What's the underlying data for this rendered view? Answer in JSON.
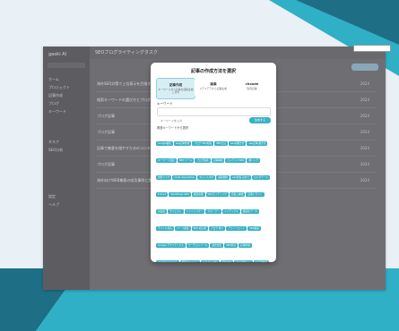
{
  "colors": {
    "teal_dark": "#1e6f86",
    "teal_mid": "#2fb0c6",
    "accent": "#3ab3c6",
    "page_bg": "#e9f1f7"
  },
  "app": {
    "logo": "gaoki AI",
    "page_title": "SEOブログライティングタスク",
    "stamp": ""
  },
  "sidebar": {
    "items": [
      "ホーム",
      "プロジェクト",
      "記事作成",
      "ブログ",
      "キーワード",
      "タスク",
      "SEO分析",
      "設定",
      "ヘルプ"
    ]
  },
  "list": {
    "rows": [
      {
        "title": "海外SEO対策で上位表示を目指すための基本戦略",
        "meta": "2024"
      },
      {
        "title": "検索キーワードの選び方とブログ記事の構成",
        "meta": "2024"
      },
      {
        "title": "ブログ記事",
        "meta": "2024"
      },
      {
        "title": "ブログ記事",
        "meta": "2024"
      },
      {
        "title": "記事で集客を増やすためのコンテンツSEO設計",
        "meta": "2024"
      },
      {
        "title": "ブログ記事",
        "meta": "2024"
      },
      {
        "title": "海外向けWEB集客の成功事例と実践ポイント",
        "meta": "2024"
      }
    ]
  },
  "modal": {
    "title": "記事の作成方法を選択",
    "options": [
      {
        "title": "記事作成",
        "sub": "キーワードから記事を自動生成します"
      },
      {
        "title": "画像",
        "sub": "Cアイデアから記事生成"
      },
      {
        "title": "choode",
        "sub": "既存記事"
      }
    ],
    "keyword_label": "キーワード",
    "keyword_placeholder": "キーワードを入力",
    "generate_button": "生成する",
    "suggest_label": "関連キーワードから選択",
    "tags": [
      "Google検索",
      "seo記事作成",
      "ブログ SEO対策",
      "SEOとは",
      "seoの書き方",
      "seo記事 書き方",
      "キーワード選定",
      "SEO ツール",
      "ブログ集客",
      "記事構成",
      "コンテンツSEO",
      "被リンク",
      "内部リンク",
      "meta description",
      "タイトルタグ",
      "検索順位",
      "seo対策 自分で",
      "ロングテール",
      "E-E-A-T",
      "WordPress SEO",
      "検索意図",
      "SEOライティング",
      "見出し構成",
      "記事リライト",
      "共起語",
      "サジェスト",
      "ドメインパワー",
      "クローラー",
      "インデックス",
      "構造化データ",
      "モバイル対応",
      "ページ速度",
      "SEO 初心者",
      "ブログ 稼ぐ",
      "アフィリエイト",
      "SNS集客",
      "Google アナリティクス",
      "サーチコンソール",
      "競合分析",
      "SEO外注",
      "記事単価",
      "キーワードツール",
      "検索ボリューム",
      "ローカルSEO",
      "海外SEO",
      "多言語サイト",
      "AI記事作成",
      "ChatGPT SEO",
      "SEO 費用",
      "SEO 会社",
      "ランキング要因",
      "アルゴリズム",
      "コアアップデート",
      "オウンドメディア",
      "リスティング広告"
    ]
  }
}
